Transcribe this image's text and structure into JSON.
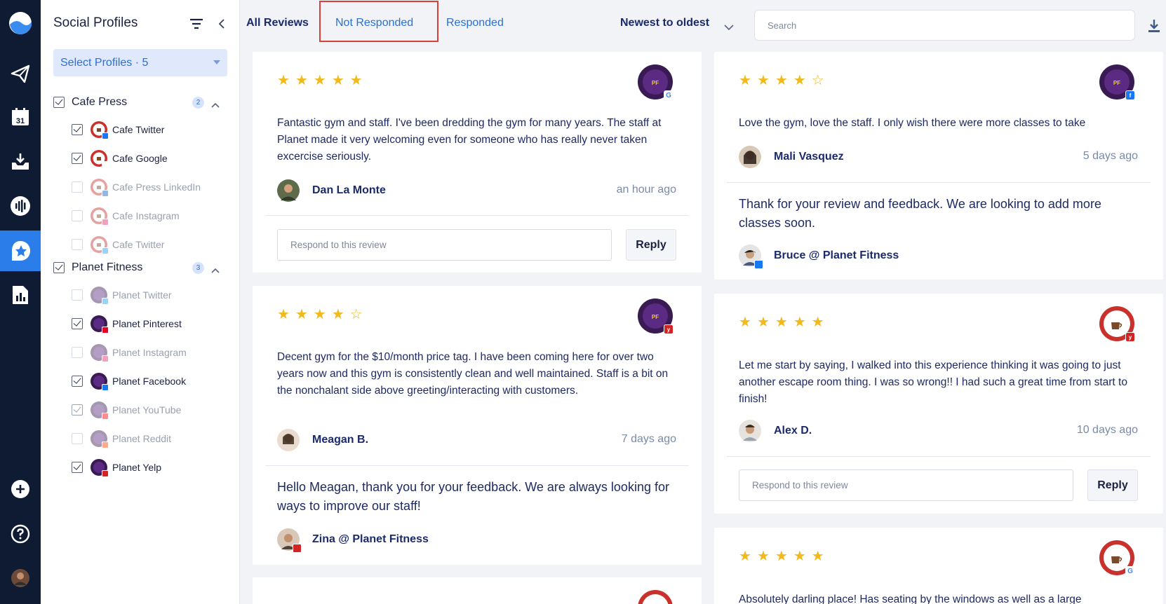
{
  "rail": {
    "icons": [
      "logo-icon",
      "paper-plane-icon",
      "calendar-icon",
      "inbox-icon",
      "listen-icon",
      "reviews-icon",
      "reports-icon",
      "add-icon",
      "help-icon",
      "user-avatar"
    ],
    "calendar_day": "31",
    "active": "reviews-icon"
  },
  "panel": {
    "title": "Social Profiles",
    "select_label": "Select Profiles · 5",
    "groups": [
      {
        "name": "Cafe Press",
        "badge": "2",
        "checked": true,
        "accounts": [
          {
            "name": "Cafe Twitter",
            "checked": true,
            "enabled": true,
            "network": "facebook"
          },
          {
            "name": "Cafe Google",
            "checked": true,
            "enabled": true,
            "network": "google"
          },
          {
            "name": "Cafe Press LinkedIn",
            "checked": false,
            "enabled": false,
            "network": "linkedin"
          },
          {
            "name": "Cafe Instagram",
            "checked": false,
            "enabled": false,
            "network": "instagram"
          },
          {
            "name": "Cafe Twitter",
            "checked": false,
            "enabled": false,
            "network": "twitter"
          }
        ]
      },
      {
        "name": "Planet Fitness",
        "badge": "3",
        "checked": true,
        "accounts": [
          {
            "name": "Planet Twitter",
            "checked": false,
            "enabled": false,
            "network": "twitter"
          },
          {
            "name": "Planet Pinterest",
            "checked": true,
            "enabled": true,
            "network": "pinterest"
          },
          {
            "name": "Planet Instagram",
            "checked": false,
            "enabled": false,
            "network": "instagram"
          },
          {
            "name": "Planet Facebook",
            "checked": true,
            "enabled": true,
            "network": "facebook"
          },
          {
            "name": "Planet YouTube",
            "checked": true,
            "enabled": false,
            "network": "youtube"
          },
          {
            "name": "Planet Reddit",
            "checked": false,
            "enabled": false,
            "network": "reddit"
          },
          {
            "name": "Planet Yelp",
            "checked": true,
            "enabled": true,
            "network": "yelp"
          }
        ]
      }
    ]
  },
  "topbar": {
    "tabs": [
      "All Reviews",
      "Not Responded",
      "Responded"
    ],
    "active_tab": "All Reviews",
    "highlighted_tab": "Not Responded",
    "sort_label": "Newest to oldest",
    "search_placeholder": "Search"
  },
  "reviews": [
    {
      "rating": 5,
      "brand": "planet-fitness",
      "network": "google",
      "text": "Fantastic gym and staff. I've been dredding the gym for many years. The staff at Planet made it very welcoming even for someone who has really never taken excercise seriously.",
      "reviewer": "Dan La Monte",
      "time": "an hour ago",
      "respond_placeholder": "Respond to this review",
      "reply_label": "Reply"
    },
    {
      "rating": 4,
      "brand": "planet-fitness",
      "network": "yelp",
      "text": "Decent gym for the $10/month price tag. I have been coming here for over two years now and this gym is consistently clean and well maintained. Staff is a bit on the nonchalant side above greeting/interacting with customers.",
      "reviewer": "Meagan B.",
      "time": "7 days ago",
      "response": "Hello Meagan, thank you for your feedback. We are always looking for ways to improve our staff!",
      "responder": "Zina @ Planet Fitness"
    },
    {
      "rating": 4,
      "brand": "planet-fitness",
      "network": "facebook",
      "text": "Love the gym, love the staff. I only wish there were more classes to take",
      "reviewer": "Mali Vasquez",
      "time": "5 days ago",
      "response": "Thank for your review and feedback. We are looking to add more classes soon.",
      "responder": "Bruce @ Planet Fitness"
    },
    {
      "rating": 5,
      "brand": "cafe-press",
      "network": "yelp",
      "text": "Let me start by saying, I walked into this experience thinking it was going to just another escape room thing. I was so wrong!! I had such a great time from start to finish!",
      "reviewer": "Alex D.",
      "time": "10 days ago",
      "respond_placeholder": "Respond to this review",
      "reply_label": "Reply"
    },
    {
      "rating": 5,
      "brand": "cafe-press",
      "network": "google",
      "text": "Absolutely darling place! Has seating by the windows as well as a large"
    }
  ],
  "colors": {
    "accent": "#2b7de9",
    "rail_bg": "#0f1a33",
    "star": "#f2b91d",
    "highlight_box": "#d9403a"
  }
}
